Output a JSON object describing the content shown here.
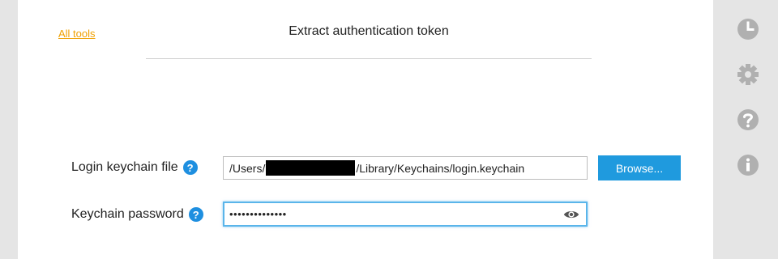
{
  "nav": {
    "all_tools": "All tools"
  },
  "page": {
    "title": "Extract authentication token"
  },
  "keychain_file": {
    "label": "Login keychain file",
    "help": "?",
    "value_prefix": "/Users/",
    "value_suffix": "/Library/Keychains/login.keychain",
    "browse_label": "Browse..."
  },
  "password": {
    "label": "Keychain password",
    "help": "?",
    "masked_value": "••••••••••••••"
  },
  "rail": {
    "icons": [
      "clock-icon",
      "gear-icon",
      "help-icon",
      "info-icon"
    ],
    "color": "#b0b0b0"
  },
  "colors": {
    "accent": "#1f9ade",
    "link": "#f0a000",
    "focus": "#5ab5ea"
  }
}
